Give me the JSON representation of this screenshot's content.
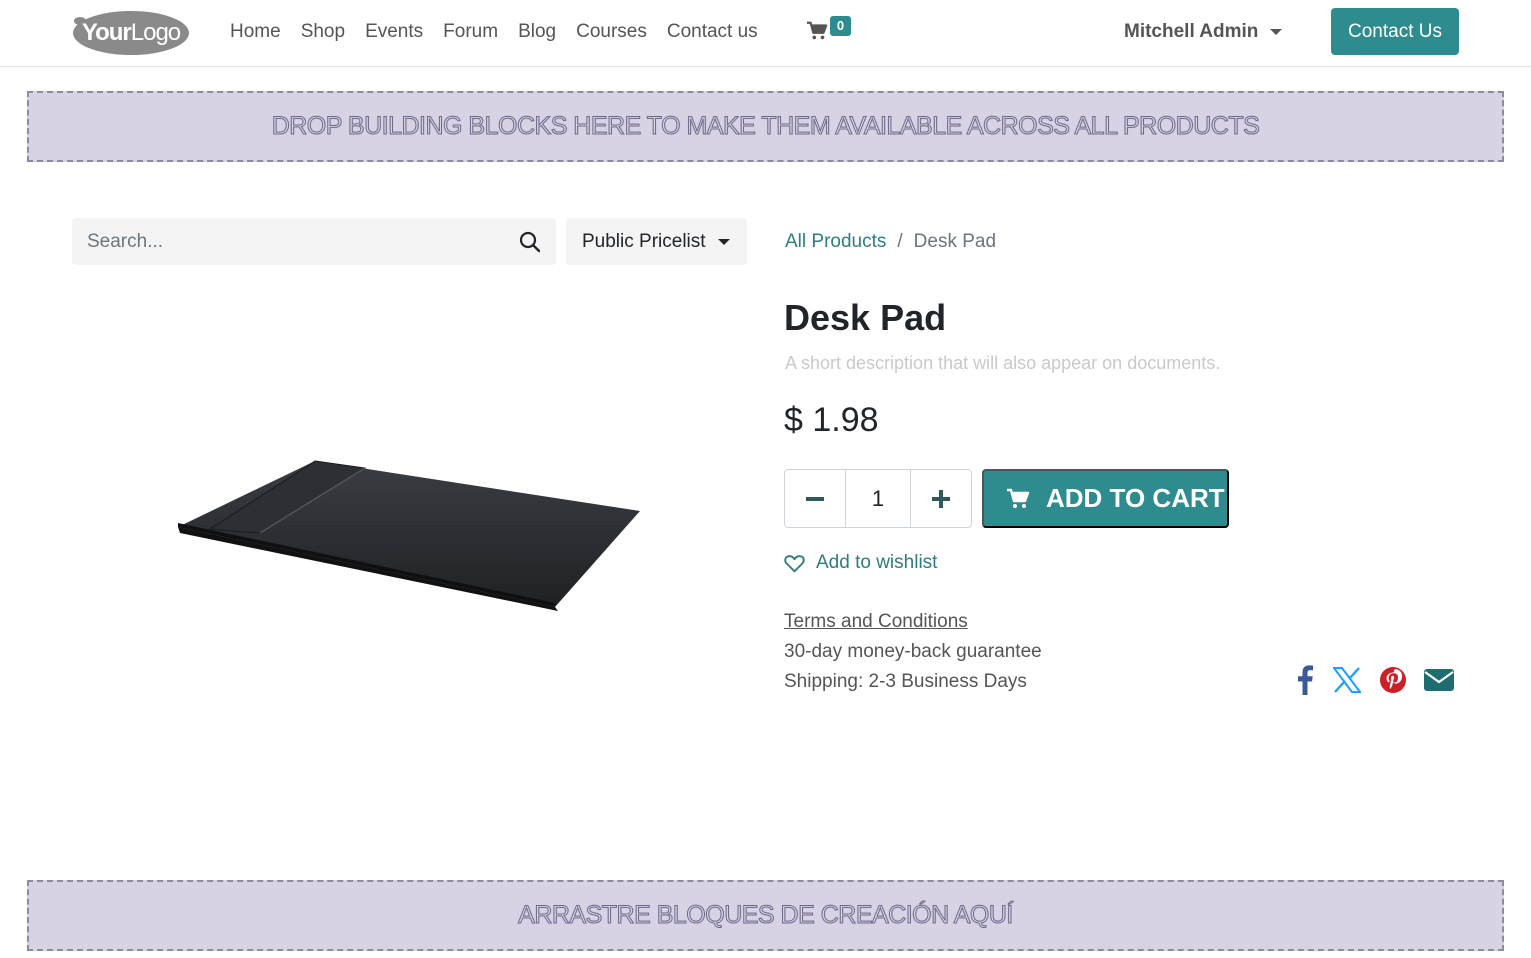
{
  "header": {
    "logo_text_bold": "Your",
    "logo_text_light": "Logo",
    "nav": [
      "Home",
      "Shop",
      "Events",
      "Forum",
      "Blog",
      "Courses",
      "Contact us"
    ],
    "cart_count": "0",
    "user_name": "Mitchell Admin",
    "contact_button": "Contact Us"
  },
  "dropzones": {
    "top": "DROP BUILDING BLOCKS HERE TO MAKE THEM AVAILABLE ACROSS ALL PRODUCTS",
    "bottom": "ARRASTRE BLOQUES DE CREACIÓN AQUÍ"
  },
  "search": {
    "placeholder": "Search...",
    "pricelist": "Public Pricelist"
  },
  "breadcrumb": {
    "parent": "All Products",
    "separator": "/",
    "current": "Desk Pad"
  },
  "product": {
    "title": "Desk Pad",
    "description": "A short description that will also appear on documents.",
    "price": "$ 1.98",
    "quantity": "1",
    "add_to_cart": "ADD TO CART",
    "wishlist": "Add to wishlist",
    "terms": "Terms and Conditions",
    "guarantee": "30-day money-back guarantee",
    "shipping": "Shipping: 2-3 Business Days"
  },
  "colors": {
    "primary": "#2e8b8e",
    "link": "#2e7d80",
    "dropzone_bg": "#d7d3e5",
    "facebook": "#3b5998",
    "twitter": "#1da1f2",
    "pinterest": "#cb2027",
    "email": "#1e6d70"
  },
  "icons": [
    "cart-icon",
    "search-icon",
    "minus-icon",
    "plus-icon",
    "heart-icon",
    "facebook-icon",
    "x-twitter-icon",
    "pinterest-icon",
    "envelope-icon"
  ]
}
